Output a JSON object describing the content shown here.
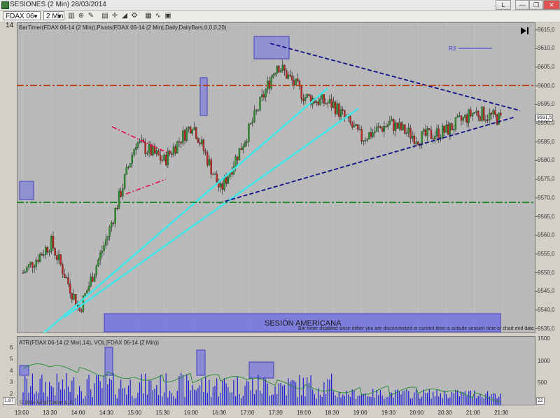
{
  "window": {
    "title": "SESIONES (2 Min)  28/03/2014",
    "buttons": [
      "L",
      "—",
      "❐",
      "✕"
    ]
  },
  "toolbar": {
    "instrument": "FDAX 06-14",
    "interval": "2 Min"
  },
  "price_panel": {
    "indicator_label": "BarTimer(FDAX 06-14 (2 Min)),Pivots(FDAX 06-14 (2 Min),Daily,DailyBars,0,0,0,20)",
    "pivot_label": "R3",
    "session_label": "SESIÓN AMERICANA",
    "bar_timer_text": "Bar timer disabled since either you are disconnected or current time is outside session time or chart end date",
    "last_price": "9591,5",
    "y_ticks": [
      "9615,0",
      "9610,0",
      "9605,0",
      "9600,0",
      "9595,0",
      "9590,0",
      "9585,0",
      "9580,0",
      "9575,0",
      "9570,0",
      "9565,0",
      "9560,0",
      "9555,0",
      "9550,0",
      "9545,0",
      "9540,0",
      "9535,0"
    ]
  },
  "lower_panel": {
    "indicator_label": "ATR(FDAX 06-14 (2 Min),14), VOL(FDAX 06-14 (2 Min))",
    "left_ticks": [
      "6",
      "5",
      "4",
      "3",
      "2"
    ],
    "right_ticks": [
      "1500",
      "1000",
      "500"
    ],
    "left_value": "1,87",
    "right_value": "22",
    "copyright": "© 2014 NinjaTrader, LLC"
  },
  "x_ticks": [
    "13:00",
    "13:30",
    "14:00",
    "14:30",
    "15:00",
    "15:30",
    "16:00",
    "16:30",
    "17:00",
    "17:30",
    "18:00",
    "18:30",
    "19:00",
    "19:30",
    "20:00",
    "20:30",
    "21:00",
    "21:30"
  ],
  "colors": {
    "resistance": "#b8441e",
    "support": "#1f8a2a",
    "trend_cyan": "#3ee6ea",
    "triangle": "#10108a",
    "flag": "#e0104a",
    "highlight": "#6a6ae8"
  },
  "chart_data": {
    "type": "line",
    "title": "",
    "xlabel": "",
    "ylabel": "",
    "ylim": [
      9534,
      9617
    ],
    "x": [
      "13:00",
      "13:30",
      "14:00",
      "14:30",
      "15:00",
      "15:30",
      "16:00",
      "16:30",
      "17:00",
      "17:30",
      "18:00",
      "18:30",
      "19:00",
      "19:30",
      "20:00",
      "20:30",
      "21:00",
      "21:30"
    ],
    "series": [
      {
        "values": [
          9550,
          9558,
          9540,
          9560,
          9585,
          9580,
          9590,
          9572,
          9588,
          9606,
          9597,
          9595,
          9586,
          9590,
          9586,
          9588,
          9593,
          9591
        ]
      }
    ],
    "levels": [
      9600,
      9568
    ],
    "volume_ylim": [
      0,
      1500
    ],
    "atr_ylim": [
      1,
      7
    ]
  }
}
